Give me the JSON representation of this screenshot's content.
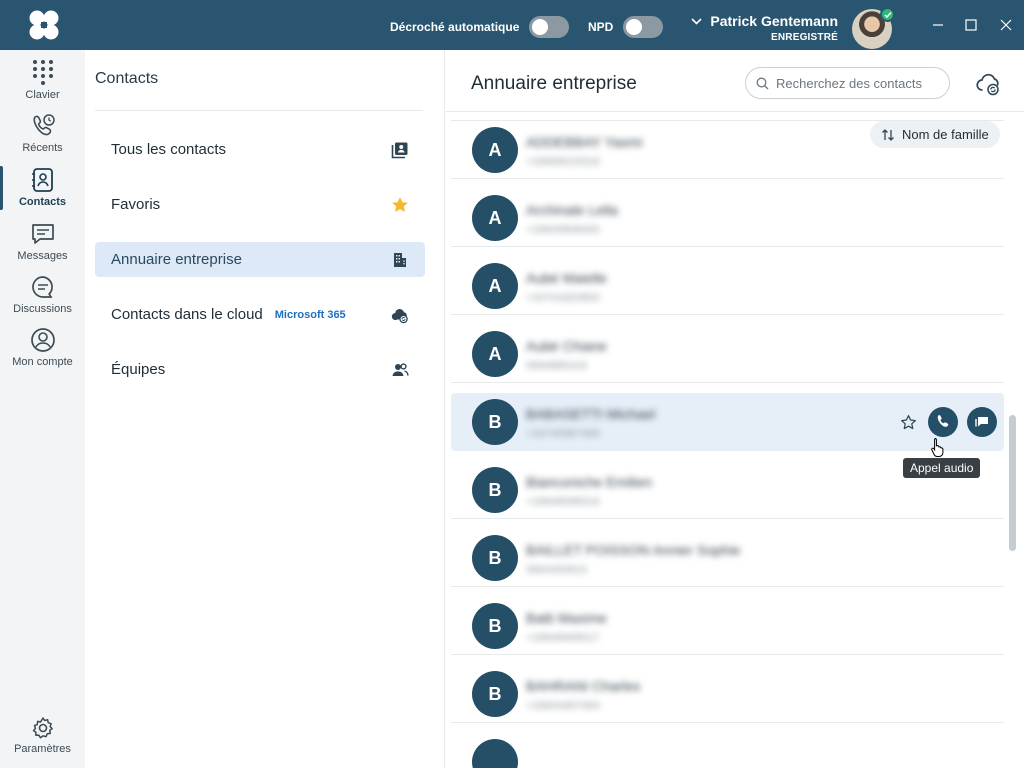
{
  "titlebar": {
    "auto_answer_label": "Décroché automatique",
    "auto_answer_on": false,
    "npd_label": "NPD",
    "npd_on": false,
    "user_name": "Patrick Gentemann",
    "user_status": "ENREGISTRÉ",
    "status_color": "#2eb872"
  },
  "nav": {
    "items": [
      {
        "label": "Clavier",
        "icon": "keypad-icon"
      },
      {
        "label": "Récents",
        "icon": "recent-calls-icon"
      },
      {
        "label": "Contacts",
        "icon": "contacts-book-icon",
        "active": true
      },
      {
        "label": "Messages",
        "icon": "message-icon"
      },
      {
        "label": "Discussions",
        "icon": "chat-icon"
      },
      {
        "label": "Mon compte",
        "icon": "user-circle-icon"
      }
    ],
    "settings_label": "Paramètres"
  },
  "contacts": {
    "title": "Contacts",
    "categories": [
      {
        "label": "Tous les contacts",
        "icon": "contacts-list-icon"
      },
      {
        "label": "Favoris",
        "icon": "star-icon"
      },
      {
        "label": "Annuaire entreprise",
        "icon": "building-icon",
        "active": true
      },
      {
        "label": "Contacts dans le cloud",
        "badge": "Microsoft 365",
        "icon": "cloud-sync-icon"
      },
      {
        "label": "Équipes",
        "icon": "team-icon"
      }
    ]
  },
  "directory": {
    "title": "Annuaire entreprise",
    "search_placeholder": "Recherchez des contacts",
    "sort_label": "Nom de famille",
    "tooltip": "Appel audio",
    "rows": [
      {
        "initial": "A",
        "name": "ADDEBBAY Yasmi",
        "number": "+33669019318"
      },
      {
        "initial": "A",
        "name": "Archinale Lella",
        "number": "+33645808400"
      },
      {
        "initial": "A",
        "name": "Aubé Maielle",
        "number": "+33741820800"
      },
      {
        "initial": "A",
        "name": "Aubé Chiane",
        "number": "0694880416"
      },
      {
        "initial": "B",
        "name": "BABASETTI Michael",
        "number": "+33745987469"
      },
      {
        "initial": "B",
        "name": "Bianconiche Emilien",
        "number": "+33648598316"
      },
      {
        "initial": "B",
        "name": "BAILLET POISSON Annier Sophie",
        "number": "0664450810"
      },
      {
        "initial": "B",
        "name": "Batti Maxime",
        "number": "+33648469017"
      },
      {
        "initial": "B",
        "name": "BAHRANI Charles",
        "number": "+33604467464"
      }
    ]
  },
  "colors": {
    "titlebar_bg": "#2a5570",
    "avatar_bg": "#244f67",
    "active_category_bg": "#dde9f6",
    "star_favorite": "#f5b82e"
  }
}
